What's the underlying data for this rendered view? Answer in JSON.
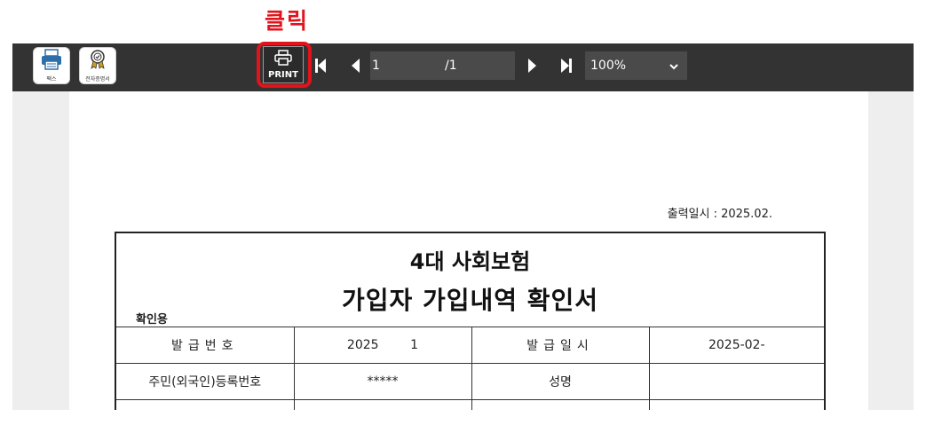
{
  "annotation": {
    "text": "클릭",
    "color": "#e1131b"
  },
  "toolbar": {
    "fax_label": "팩스",
    "fax_icon": "fax-icon",
    "cert_label": "전자증명서",
    "cert_icon": "certificate-badge-icon",
    "print_label": "PRINT",
    "print_icon": "printer-icon",
    "current_page": "1",
    "total_pages": "/1",
    "zoom_value": "100%"
  },
  "document": {
    "printed_at": "출력일시 : 2025.02.",
    "title_line1": "4대 사회보험",
    "title_line2": "가입자 가입내역 확인서",
    "copy_type": "확인용",
    "rows": [
      {
        "label1": "발급번호",
        "value1": "2025        1",
        "label2": "발급일시",
        "value2": "2025-02-"
      },
      {
        "label1": "주민(외국인)등록번호",
        "value1": "*****",
        "label2": "성명",
        "value2": ""
      }
    ]
  }
}
